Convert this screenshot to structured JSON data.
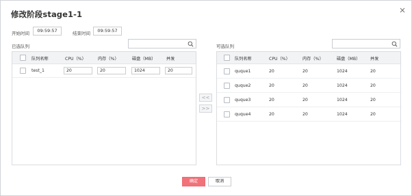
{
  "dialog": {
    "title": "修改阶段stage1-1",
    "close_icon": "close-icon"
  },
  "time": {
    "start_label": "开始时间",
    "start_value": "09:59:57",
    "end_label": "结束时间",
    "end_value": "09:59:57"
  },
  "selected": {
    "label": "已选队列",
    "search_placeholder": "",
    "headers": [
      "队列名称",
      "CPU（%）",
      "内存（%）",
      "磁盘（MB）",
      "并发"
    ],
    "rows": [
      {
        "name": "test_1",
        "cpu": "20",
        "mem": "20",
        "disk": "1024",
        "conc": "20"
      }
    ]
  },
  "available": {
    "label": "可选队列",
    "search_placeholder": "",
    "headers": [
      "队列名称",
      "CPU（%）",
      "内存（%）",
      "磁盘（MB）",
      "并发"
    ],
    "rows": [
      {
        "name": "quque1",
        "cpu": "20",
        "mem": "20",
        "disk": "1024",
        "conc": "20"
      },
      {
        "name": "quque2",
        "cpu": "20",
        "mem": "20",
        "disk": "1024",
        "conc": "20"
      },
      {
        "name": "quque3",
        "cpu": "20",
        "mem": "20",
        "disk": "1024",
        "conc": "20"
      },
      {
        "name": "quque4",
        "cpu": "20",
        "mem": "20",
        "disk": "1024",
        "conc": "20"
      }
    ]
  },
  "transfer": {
    "left_label": "<<",
    "right_label": ">>"
  },
  "footer": {
    "ok_label": "确定",
    "cancel_label": "取消"
  },
  "colors": {
    "primary": "#f1727a",
    "border": "#d9dce0",
    "header_bg": "#f2f3f5"
  }
}
